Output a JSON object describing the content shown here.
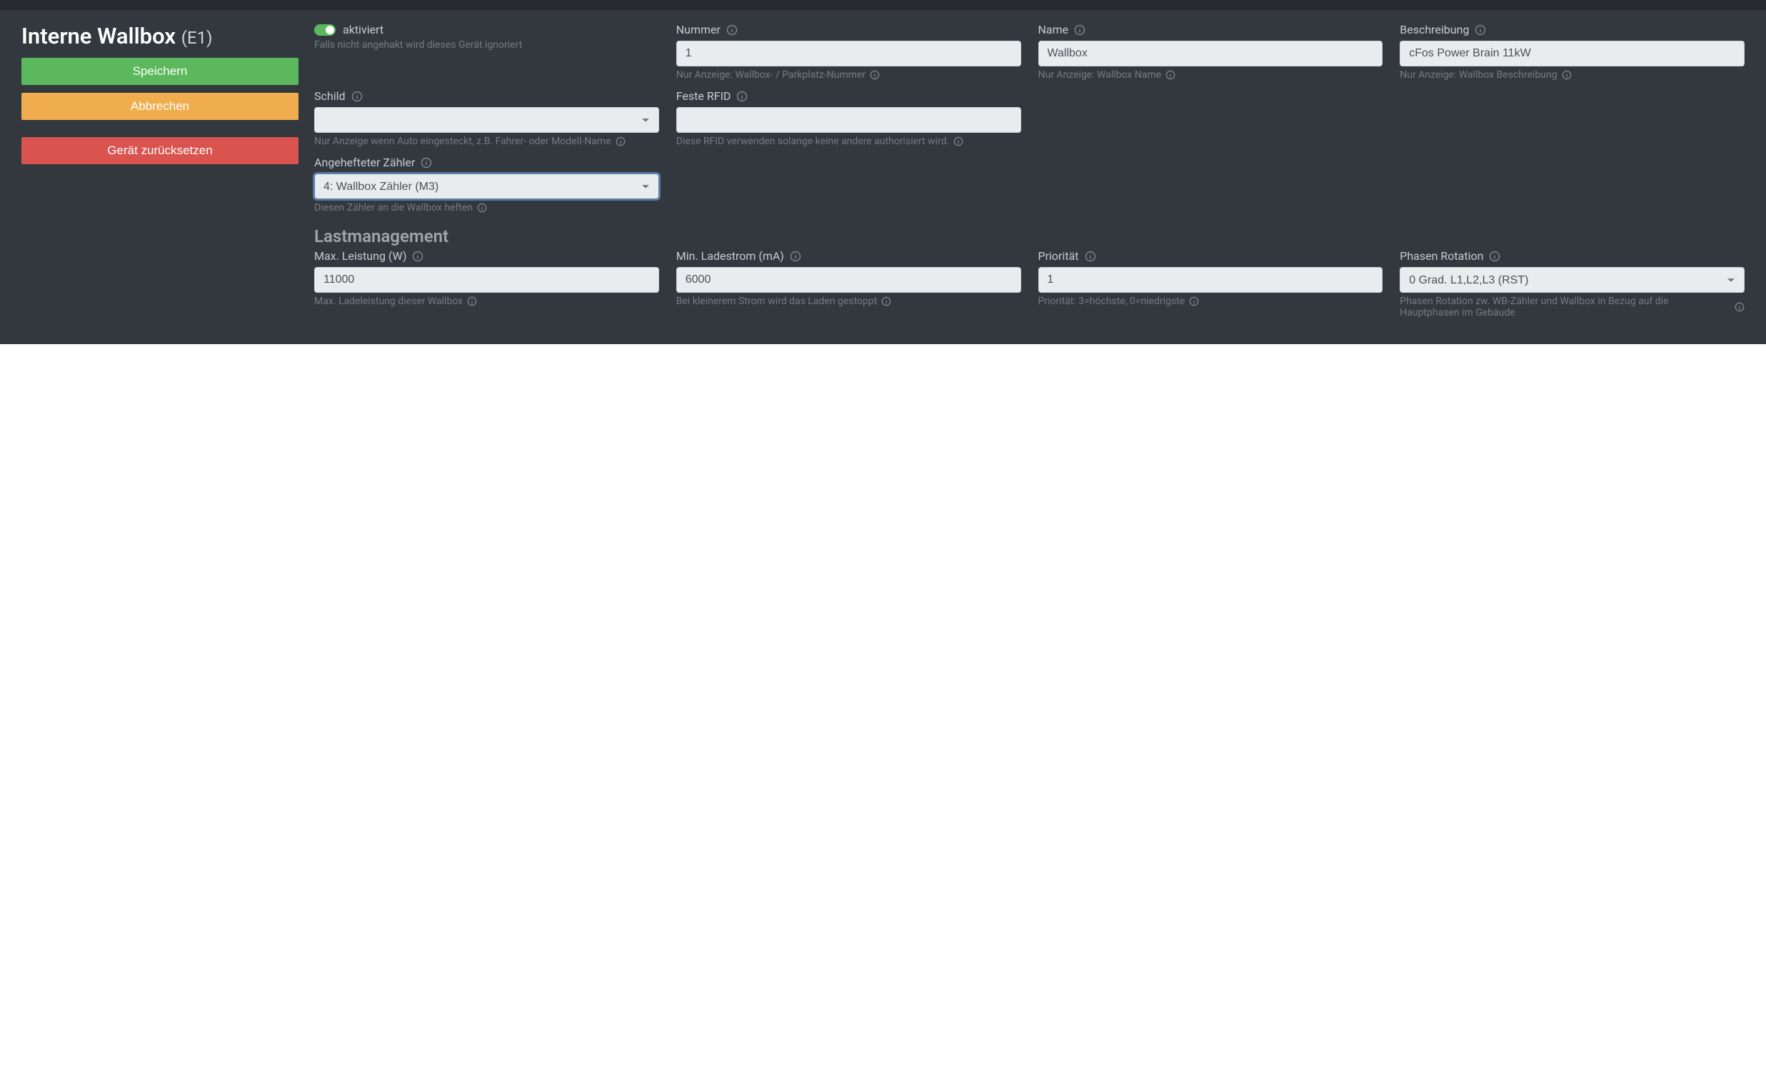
{
  "header": {
    "title_main": "Interne Wallbox",
    "title_suffix": "(E1)"
  },
  "buttons": {
    "save": "Speichern",
    "cancel": "Abbrechen",
    "reset": "Gerät zurücksetzen"
  },
  "fields": {
    "aktiviert": {
      "label": "aktiviert",
      "hint": "Falls nicht angehakt wird dieses Gerät ignoriert"
    },
    "nummer": {
      "label": "Nummer",
      "value": "1",
      "hint": "Nur Anzeige: Wallbox- / Parkplatz-Nummer"
    },
    "name": {
      "label": "Name",
      "value": "Wallbox",
      "hint": "Nur Anzeige: Wallbox Name"
    },
    "beschreibung": {
      "label": "Beschreibung",
      "value": "cFos Power Brain 11kW",
      "hint": "Nur Anzeige: Wallbox Beschreibung"
    },
    "schild": {
      "label": "Schild",
      "value": "",
      "hint": "Nur Anzeige wenn Auto eingesteckt, z.B. Fahrer- oder Modell-Name"
    },
    "feste_rfid": {
      "label": "Feste RFID",
      "value": "",
      "hint": "Diese RFID verwenden solange keine andere authorisiert wird."
    },
    "angehefteter_zaehler": {
      "label": "Angehefteter Zähler",
      "value": "4: Wallbox Zähler (M3)",
      "hint": "Diesen Zähler an die Wallbox heften"
    }
  },
  "sections": {
    "lastmanagement": "Lastmanagement"
  },
  "lm": {
    "max_leistung": {
      "label": "Max. Leistung (W)",
      "value": "11000",
      "hint": "Max. Ladeleistung dieser Wallbox"
    },
    "min_ladestrom": {
      "label": "Min. Ladestrom (mA)",
      "value": "6000",
      "hint": "Bei kleinerem Strom wird das Laden gestoppt"
    },
    "prioritaet": {
      "label": "Priorität",
      "value": "1",
      "hint": "Priorität: 3=höchste, 0=niedrigste"
    },
    "phasen_rotation": {
      "label": "Phasen Rotation",
      "value": "0 Grad. L1,L2,L3 (RST)",
      "hint": "Phasen Rotation zw. WB-Zähler und Wallbox in Bezug auf die Hauptphasen im Gebäude"
    }
  }
}
